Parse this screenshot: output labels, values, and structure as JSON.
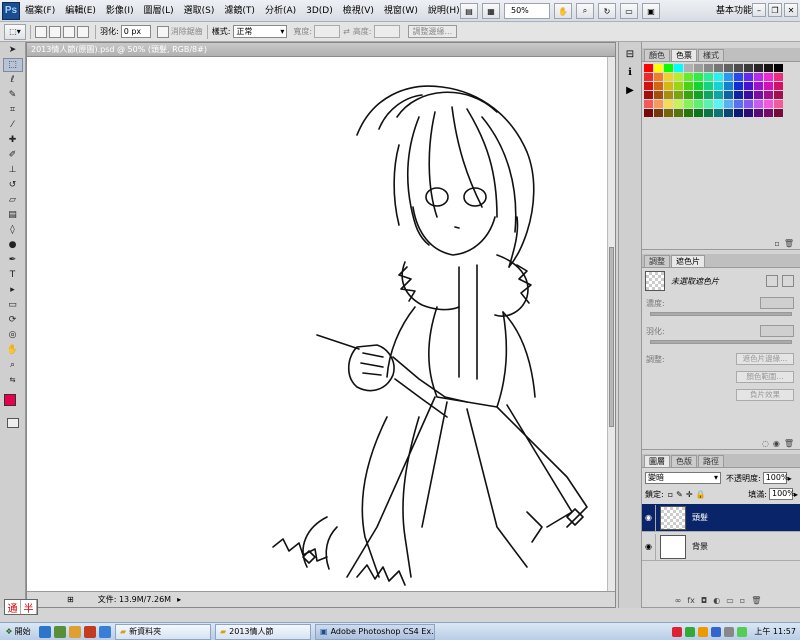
{
  "menubar": {
    "logo": "Ps",
    "items": [
      "檔案(F)",
      "編輯(E)",
      "影像(I)",
      "圖層(L)",
      "選取(S)",
      "濾鏡(T)",
      "分析(A)",
      "3D(D)",
      "檢視(V)",
      "視窗(W)",
      "說明(H)"
    ],
    "zoom": "50%",
    "workspace": "基本功能"
  },
  "options": {
    "feather_label": "羽化:",
    "feather_value": "0 px",
    "antialias_label": "消除鋸齒",
    "style_label": "樣式:",
    "style_value": "正常",
    "width_label": "寬度:",
    "height_label": "高度:",
    "refine_button": "調整邊緣..."
  },
  "document": {
    "title": "2013情人節(原圖).psd @ 50% (頭髮, RGB/8#)",
    "status": "文件: 13.9M/7.26M"
  },
  "colors": {
    "foreground": "#e8004c",
    "background": "#ffffff",
    "selected_layer": "#0a246a"
  },
  "panels": {
    "swatches_tabs": [
      "顏色",
      "色票",
      "樣式"
    ],
    "masks_tabs": [
      "調整",
      "遮色片"
    ],
    "no_mask": "未選取遮色片",
    "density_label": "濃度:",
    "feather_label": "羽化:",
    "refine_label": "調整:",
    "mask_edge_button": "遮色片邊緣...",
    "color_range_button": "顏色範圍...",
    "invert_button": "負片效果",
    "layers_tabs": [
      "圖層",
      "色版",
      "路徑"
    ],
    "blend_mode": "變暗",
    "opacity_label": "不透明度:",
    "opacity_value": "100%",
    "lock_label": "鎖定:",
    "fill_label": "填滿:",
    "fill_value": "100%",
    "layers": [
      {
        "name": "頭髮",
        "selected": true
      },
      {
        "name": "背景",
        "selected": false
      }
    ]
  },
  "ime": {
    "a": "通",
    "b": "半"
  },
  "taskbar": {
    "start": "開始",
    "tasks": [
      "新資料夾",
      "2013情人節",
      "Adobe Photoshop CS4 Ex..."
    ],
    "clock": "上午 11:57"
  }
}
